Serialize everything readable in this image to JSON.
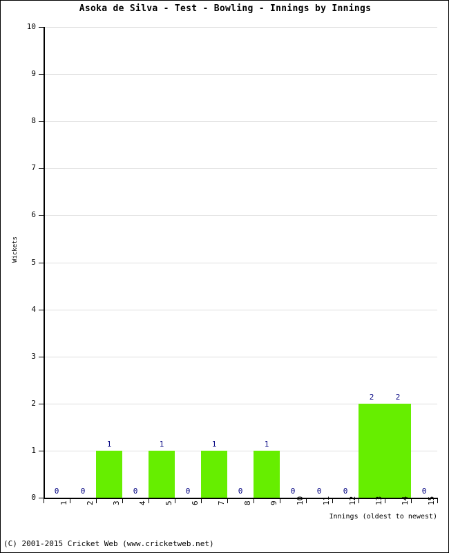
{
  "chart_data": {
    "type": "bar",
    "title": "Asoka de Silva - Test - Bowling - Innings by Innings",
    "xlabel": "Innings (oldest to newest)",
    "ylabel": "Wickets",
    "categories": [
      "1",
      "2",
      "3",
      "4",
      "5",
      "6",
      "7",
      "8",
      "9",
      "10",
      "11",
      "12",
      "13",
      "14",
      "15"
    ],
    "values": [
      0,
      0,
      1,
      0,
      1,
      0,
      1,
      0,
      1,
      0,
      0,
      0,
      2,
      2,
      0
    ],
    "data_labels": [
      "0",
      "0",
      "1",
      "0",
      "1",
      "0",
      "1",
      "0",
      "1",
      "0",
      "0",
      "0",
      "2",
      "2",
      "0"
    ],
    "ylim": [
      0,
      10
    ],
    "ytick_labels": [
      "0",
      "1",
      "2",
      "3",
      "4",
      "5",
      "6",
      "7",
      "8",
      "9",
      "10"
    ],
    "ytick_values": [
      0,
      1,
      2,
      3,
      4,
      5,
      6,
      7,
      8,
      9,
      10
    ],
    "grid": true,
    "legend": false,
    "bar_color": "#66EE00",
    "data_label_color": "#000080",
    "gridline_color": "#DDDDDD",
    "axis_color": "#000000",
    "background_color": "#FFFFFF"
  },
  "footer": {
    "copyright": "(C) 2001-2015 Cricket Web (www.cricketweb.net)"
  }
}
